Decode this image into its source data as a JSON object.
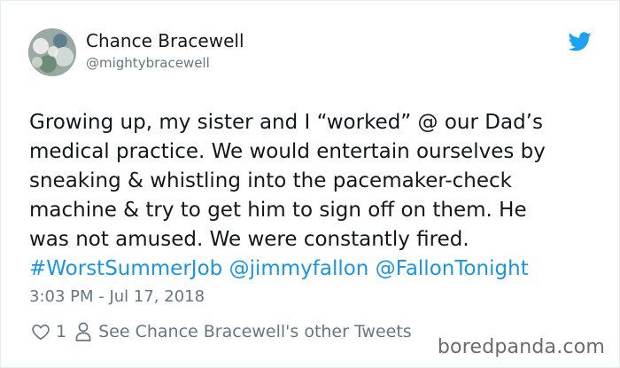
{
  "tweet": {
    "author_name": "Chance Bracewell",
    "author_handle": "@mightybracewell",
    "text_lines": [
      "Growing up, my sister and I “worked” @ our Dad’s",
      "medical practice. We would entertain ourselves by",
      "sneaking & whistling into the pacemaker-check",
      "machine & try to get him to sign off on them. He",
      "was not amused. We were constantly fired."
    ],
    "hashtag": "#WorstSummerJob",
    "mention_1": "@jimmyfallon",
    "mention_2": "@FallonTonight",
    "timestamp": "3:03 PM - Jul 17, 2018",
    "like_count": "1",
    "profile_link": "See Chance Bracewell's other Tweets"
  },
  "icons": {
    "brand": "twitter-bird-icon",
    "like": "heart-outline-icon",
    "profile": "person-outline-icon"
  },
  "colors": {
    "link": "#1b95e0",
    "muted": "#657786",
    "text": "#14171a",
    "twitter_blue": "#1da1f2"
  },
  "watermark": "boredpanda.com"
}
